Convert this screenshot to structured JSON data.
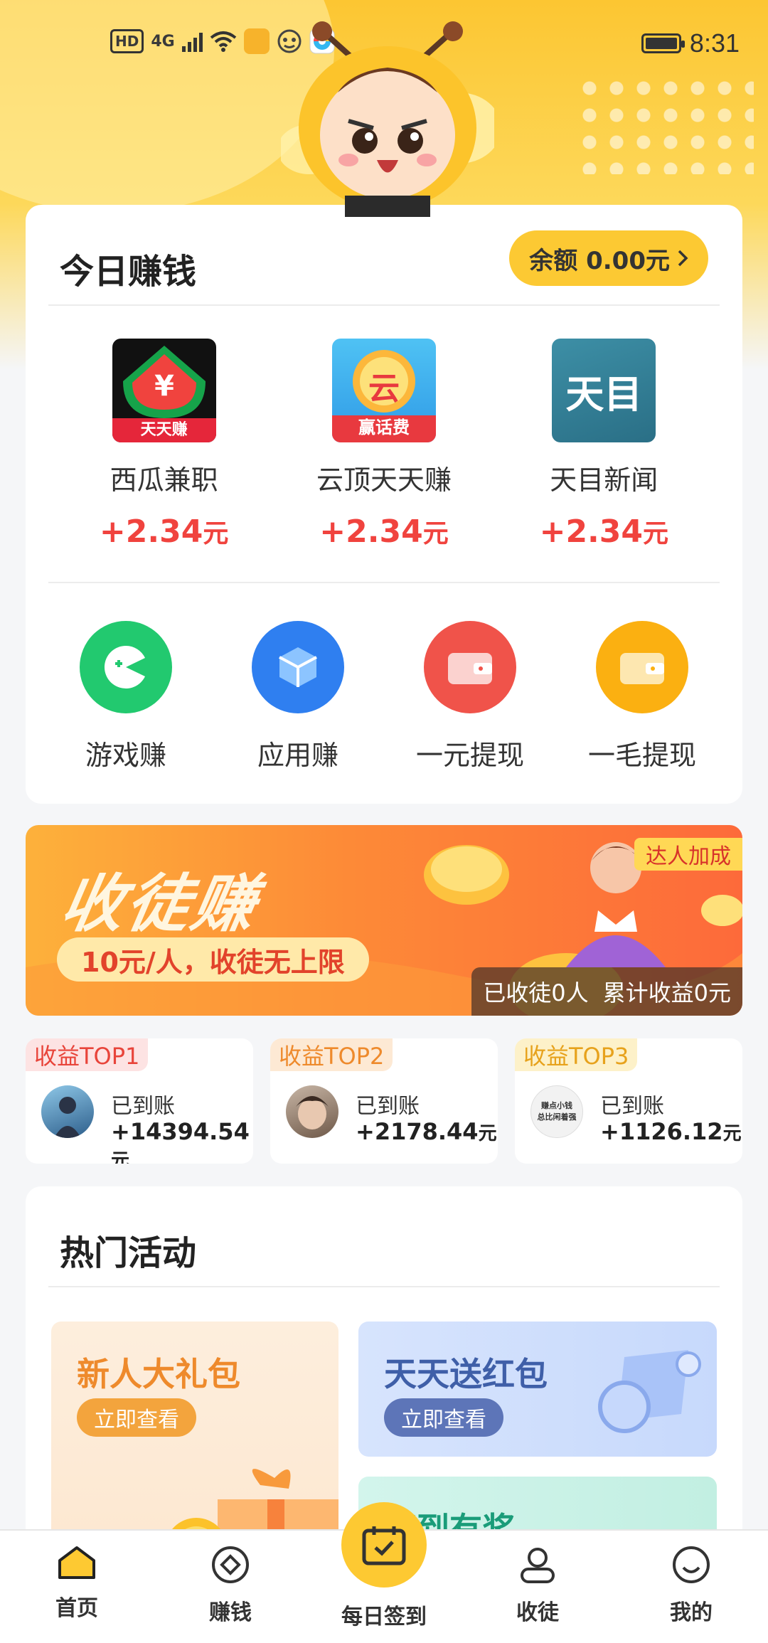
{
  "status_bar": {
    "hd": "HD",
    "network": "4G",
    "time": "8:31"
  },
  "earn_today": {
    "title": "今日赚钱",
    "balance_label": "余额 0.00元",
    "apps": [
      {
        "name": "西瓜兼职",
        "icon_text": "天天赚",
        "reward": "+2.34",
        "unit": "元"
      },
      {
        "name": "云顶天天赚",
        "icon_text": "赢话费",
        "icon_char": "云",
        "reward": "+2.34",
        "unit": "元"
      },
      {
        "name": "天目新闻",
        "icon_text": "天目",
        "reward": "+2.34",
        "unit": "元"
      }
    ],
    "features": [
      {
        "label": "游戏赚",
        "color": "#22c96f"
      },
      {
        "label": "应用赚",
        "color": "#2f7ff0"
      },
      {
        "label": "一元提现",
        "color": "#f0534a"
      },
      {
        "label": "一毛提现",
        "color": "#fbb011"
      }
    ]
  },
  "banner": {
    "title": "收徒赚",
    "subtitle": "10元/人，收徒无上限",
    "tag": "达人加成",
    "stats_recruited": "已收徒0人",
    "stats_income": "累计收益0元"
  },
  "top_earners": [
    {
      "badge": "收益TOP1",
      "status": "已到账",
      "amount": "+14394.54",
      "unit": "元",
      "badge_bg": "#fde3e3",
      "badge_color": "#e8443a"
    },
    {
      "badge": "收益TOP2",
      "status": "已到账",
      "amount": "+2178.44",
      "unit": "元",
      "badge_bg": "#fde9d4",
      "badge_color": "#ee8a2c"
    },
    {
      "badge": "收益TOP3",
      "status": "已到账",
      "amount": "+1126.12",
      "unit": "元",
      "badge_bg": "#fdf1c9",
      "badge_color": "#e7a21c",
      "avatar_text_1": "赚点小钱",
      "avatar_text_2": "总比闲着强"
    }
  ],
  "hot_activities": {
    "title": "热门活动",
    "items": [
      {
        "title": "新人大礼包",
        "button": "立即查看"
      },
      {
        "title": "天天送红包",
        "button": "立即查看"
      },
      {
        "title": "签到有奖"
      }
    ]
  },
  "bottom_nav": {
    "items": [
      {
        "label": "首页"
      },
      {
        "label": "赚钱"
      },
      {
        "label": "每日签到"
      },
      {
        "label": "收徒"
      },
      {
        "label": "我的"
      }
    ]
  },
  "colors": {
    "brand_yellow": "#fcc933",
    "reward_red": "#f0433e"
  }
}
